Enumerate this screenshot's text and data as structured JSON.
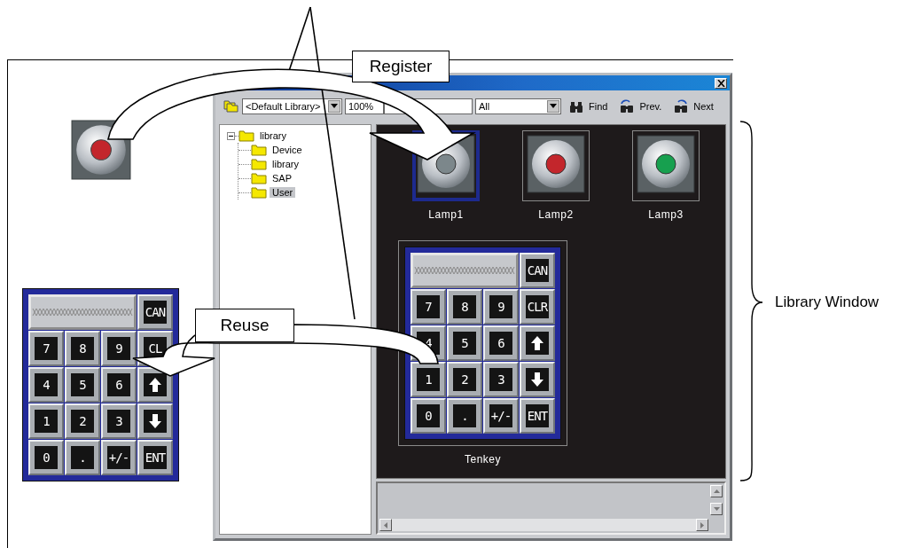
{
  "window": {
    "toolbar": {
      "library_select": "<Default Library>",
      "zoom_select": "100%",
      "filter_select": "All",
      "buttons": [
        {
          "label": "Find",
          "kind": "find"
        },
        {
          "label": "Prev.",
          "kind": "prev"
        },
        {
          "label": "Next",
          "kind": "next"
        }
      ]
    },
    "tree": [
      {
        "label": "library",
        "expanded": true,
        "selected": false,
        "children": [
          {
            "label": "Device",
            "selected": false
          },
          {
            "label": "library",
            "selected": false
          },
          {
            "label": "SAP",
            "selected": false
          },
          {
            "label": "User",
            "selected": true
          }
        ]
      }
    ],
    "parts": [
      {
        "name": "Lamp1",
        "kind": "lamp",
        "selected": true,
        "color": "#7c878b"
      },
      {
        "name": "Lamp2",
        "kind": "lamp",
        "selected": false,
        "color": "#c3262c"
      },
      {
        "name": "Lamp3",
        "kind": "lamp",
        "selected": false,
        "color": "#17a04f"
      },
      {
        "name": "Tenkey",
        "kind": "tenkey",
        "selected": false,
        "keypad": {
          "cancel_key": "CAN",
          "keys": [
            {
              "kind": "label",
              "label": "7"
            },
            {
              "kind": "label",
              "label": "8"
            },
            {
              "kind": "label",
              "label": "9"
            },
            {
              "kind": "label",
              "label": "CLR"
            },
            {
              "kind": "label",
              "label": "4"
            },
            {
              "kind": "label",
              "label": "5"
            },
            {
              "kind": "label",
              "label": "6"
            },
            {
              "kind": "up"
            },
            {
              "kind": "label",
              "label": "1"
            },
            {
              "kind": "label",
              "label": "2"
            },
            {
              "kind": "label",
              "label": "3"
            },
            {
              "kind": "down"
            },
            {
              "kind": "label",
              "label": "0"
            },
            {
              "kind": "label",
              "label": "."
            },
            {
              "kind": "label",
              "label": "+/-"
            },
            {
              "kind": "label",
              "label": "ENT"
            }
          ]
        }
      }
    ]
  },
  "diagram": {
    "source_lamp": {
      "color": "#c3262c"
    },
    "register_label": "Register",
    "reuse_label": "Reuse",
    "bracket_label": "Library Window",
    "reused_tenkey": {
      "cancel_key": "CAN",
      "keys": [
        {
          "kind": "label",
          "label": "7"
        },
        {
          "kind": "label",
          "label": "8"
        },
        {
          "kind": "label",
          "label": "9"
        },
        {
          "kind": "label",
          "label": "CL"
        },
        {
          "kind": "label",
          "label": "4"
        },
        {
          "kind": "label",
          "label": "5"
        },
        {
          "kind": "label",
          "label": "6"
        },
        {
          "kind": "up"
        },
        {
          "kind": "label",
          "label": "1"
        },
        {
          "kind": "label",
          "label": "2"
        },
        {
          "kind": "label",
          "label": "3"
        },
        {
          "kind": "down"
        },
        {
          "kind": "label",
          "label": "0"
        },
        {
          "kind": "label",
          "label": "."
        },
        {
          "kind": "label",
          "label": "+/-"
        },
        {
          "kind": "label",
          "label": "ENT"
        }
      ]
    }
  }
}
